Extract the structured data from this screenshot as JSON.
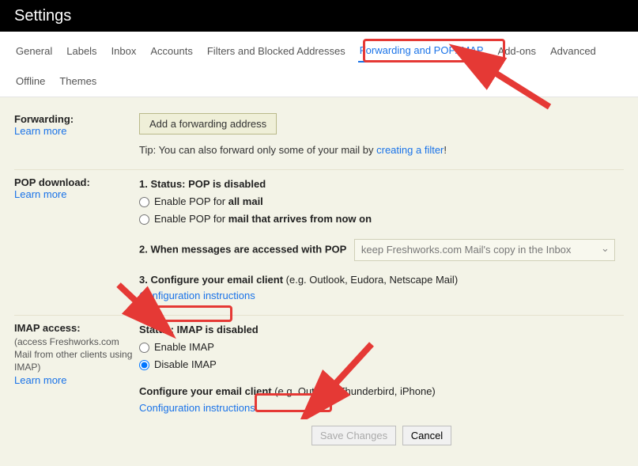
{
  "header": {
    "title": "Settings"
  },
  "tabs": {
    "row1": [
      "General",
      "Labels",
      "Inbox",
      "Accounts",
      "Filters and Blocked Addresses",
      "Forwarding and POP/IMAP",
      "Add-ons",
      "Advanced"
    ],
    "row2": [
      "Offline",
      "Themes"
    ],
    "active": "Forwarding and POP/IMAP"
  },
  "forwarding": {
    "title": "Forwarding:",
    "learn": "Learn more",
    "button": "Add a forwarding address",
    "tip_pre": "Tip: You can also forward only some of your mail by ",
    "tip_link": "creating a filter",
    "tip_post": "!"
  },
  "pop": {
    "title": "POP download:",
    "learn": "Learn more",
    "status_label": "1. Status: ",
    "status_value": "POP is disabled",
    "radio1_pre": "Enable POP for ",
    "radio1_bold": "all mail",
    "radio2_pre": "Enable POP for ",
    "radio2_bold": "mail that arrives from now on",
    "step2": "2. When messages are accessed with POP",
    "select_value": "keep Freshworks.com Mail's copy in the Inbox",
    "step3_pre": "3. Configure your email client ",
    "step3_eg": "(e.g. Outlook, Eudora, Netscape Mail)",
    "config_link": "Configuration instructions"
  },
  "imap": {
    "title": "IMAP access:",
    "sub": "(access Freshworks.com Mail from other clients using IMAP)",
    "learn": "Learn more",
    "status": "Status: IMAP is disabled",
    "enable": "Enable IMAP",
    "disable": "Disable IMAP",
    "cfg_pre": "Configure your email client ",
    "cfg_eg": "(e.g. Outlook, Thunderbird, iPhone)",
    "config_link": "Configuration instructions"
  },
  "buttons": {
    "save": "Save Changes",
    "cancel": "Cancel"
  }
}
